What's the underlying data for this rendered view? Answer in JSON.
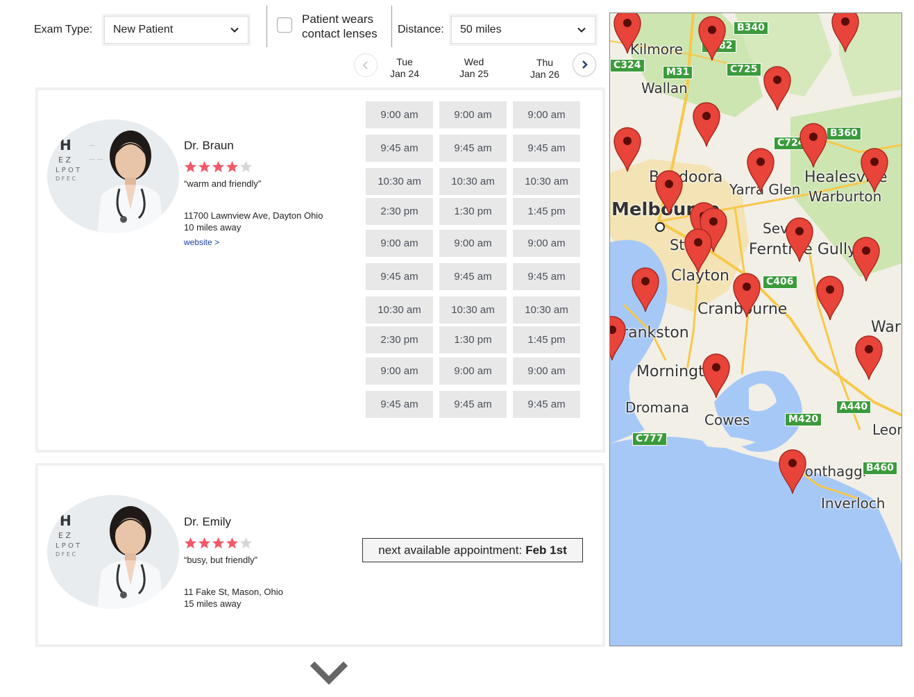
{
  "filters": {
    "exam_type_label": "Exam Type:",
    "exam_type_value": "New Patient",
    "contact_lenses_line1": "Patient wears",
    "contact_lenses_line2": "contact lenses",
    "distance_label": "Distance:",
    "distance_value": "50 miles"
  },
  "dates": [
    {
      "day": "Tue",
      "date": "Jan 24"
    },
    {
      "day": "Wed",
      "date": "Jan 25"
    },
    {
      "day": "Thu",
      "date": "Jan 26"
    }
  ],
  "doctors": [
    {
      "name": "Dr. Braun",
      "rating": 4,
      "max_rating": 5,
      "quote": "“warm and friendly”",
      "address": "11700 Lawnview Ave, Dayton Ohio",
      "distance": "10 miles away",
      "website": "website >",
      "slots": [
        [
          "9:00 am",
          "9:00 am",
          "9:00 am"
        ],
        [
          "9:45 am",
          "9:45 am",
          "9:45 am"
        ],
        [
          "10:30 am",
          "10:30 am",
          "10:30 am"
        ],
        [
          "2:30 pm",
          "1:30 pm",
          "1:45 pm"
        ],
        [
          "9:00 am",
          "9:00 am",
          "9:00 am"
        ],
        [
          "9:45 am",
          "9:45 am",
          "9:45 am"
        ],
        [
          "10:30 am",
          "10:30 am",
          "10:30 am"
        ],
        [
          "2:30 pm",
          "1:30 pm",
          "1:45 pm"
        ],
        [
          "9:00 am",
          "9:00 am",
          "9:00 am"
        ],
        [
          "9:45 am",
          "9:45 am",
          "9:45 am"
        ]
      ]
    },
    {
      "name": "Dr. Emily",
      "rating": 4,
      "max_rating": 5,
      "quote": "“busy, but friendly”",
      "address": "11 Fake St, Mason, Ohio",
      "distance": "15 miles away",
      "next_available_label": "next available appointment:",
      "next_available_date": "Feb 1st"
    }
  ],
  "map": {
    "places": [
      "Kilmore",
      "Wallan",
      "Bundoora",
      "Yarra Glen",
      "Healesville",
      "Warburton",
      "Melbourne",
      "St K",
      "Sev",
      "Ferntree Gully",
      "Clayton",
      "Cranbourne",
      "Frankston",
      "Mornington",
      "Dromana",
      "Cowes",
      "Wonthaggi",
      "Inverloch",
      "War",
      "Leon"
    ],
    "roads": [
      "B340",
      "C382",
      "C324",
      "M31",
      "C725",
      "C724",
      "B360",
      "C406",
      "A440",
      "M420",
      "C777",
      "B460"
    ],
    "colors": {
      "water": "#a6c8f7",
      "land": "#f2efe6",
      "park": "#cde5b0",
      "pin": "#e8443a",
      "road": "#f7c84a",
      "badge": "#3b9b3b"
    }
  }
}
